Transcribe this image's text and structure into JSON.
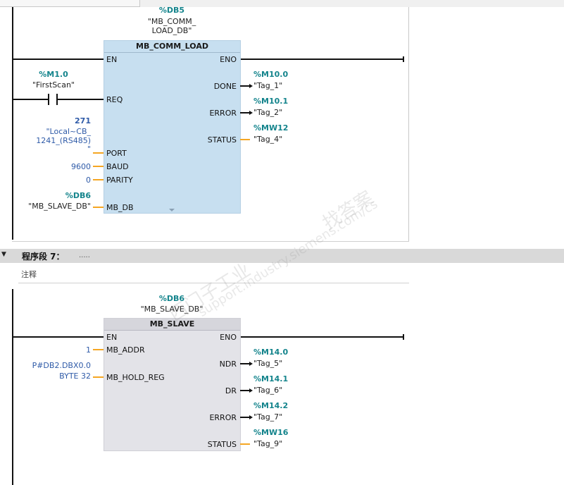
{
  "network1": {
    "instance_db": "%DB5",
    "instance_db_name_line1": "\"MB_COMM_",
    "instance_db_name_line2": "LOAD_DB\"",
    "block": {
      "name": "MB_COMM_LOAD",
      "pins": {
        "en": "EN",
        "eno": "ENO",
        "req": "REQ",
        "port": "PORT",
        "baud": "BAUD",
        "parity": "PARITY",
        "mb_db": "MB_DB",
        "done": "DONE",
        "error": "ERROR",
        "status": "STATUS"
      }
    },
    "req_contact": {
      "address": "%M1.0",
      "symbol": "\"FirstScan\""
    },
    "port_param": {
      "value": "271",
      "line1": "\"Local~CB_",
      "line2": "1241_(RS485)",
      "line3": "\""
    },
    "baud_value": "9600",
    "parity_value": "0",
    "mb_db_param": {
      "address": "%DB6",
      "symbol": "\"MB_SLAVE_DB\""
    },
    "outputs": {
      "done": {
        "address": "%M10.0",
        "symbol": "\"Tag_1\""
      },
      "error": {
        "address": "%M10.1",
        "symbol": "\"Tag_2\""
      },
      "status": {
        "address": "%MW12",
        "symbol": "\"Tag_4\""
      }
    }
  },
  "section7": {
    "title": "程序段 7：",
    "dots": ".....",
    "comment_label": "注释"
  },
  "network2": {
    "instance_db": "%DB6",
    "instance_db_name": "\"MB_SLAVE_DB\"",
    "block": {
      "name": "MB_SLAVE",
      "pins": {
        "en": "EN",
        "eno": "ENO",
        "mb_addr": "MB_ADDR",
        "mb_hold_reg": "MB_HOLD_REG",
        "ndr": "NDR",
        "dr": "DR",
        "error": "ERROR",
        "status": "STATUS"
      }
    },
    "mb_addr_value": "1",
    "hold_reg_line1": "P#DB2.DBX0.0",
    "hold_reg_line2": "BYTE 32",
    "outputs": {
      "ndr": {
        "address": "%M14.0",
        "symbol": "\"Tag_5\""
      },
      "dr": {
        "address": "%M14.1",
        "symbol": "\"Tag_6\""
      },
      "error": {
        "address": "%M14.2",
        "symbol": "\"Tag_7\""
      },
      "status": {
        "address": "%MW16",
        "symbol": "\"Tag_9\""
      }
    }
  },
  "watermark": {
    "line1": "西门子工业",
    "line2": "找答案",
    "line3": "support.industry.siemens.com/cs"
  }
}
